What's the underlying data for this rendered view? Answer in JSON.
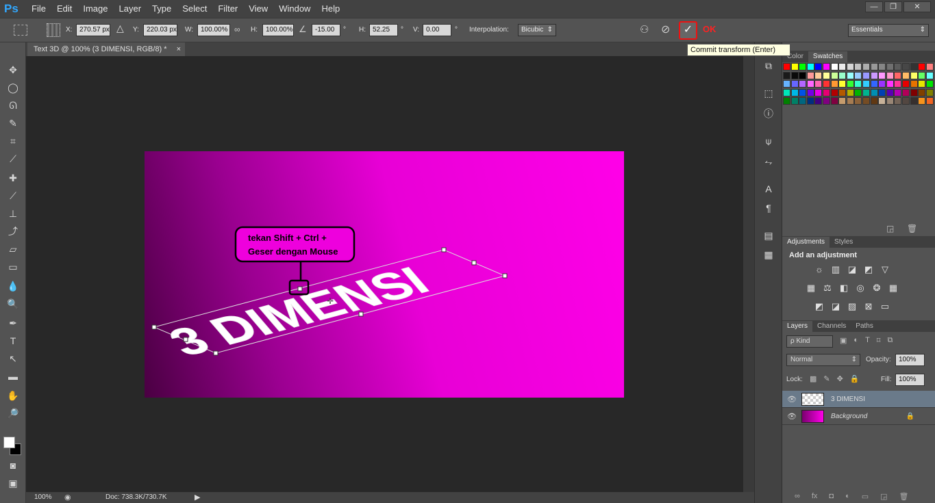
{
  "app": {
    "logo": "Ps"
  },
  "menu": [
    "File",
    "Edit",
    "Image",
    "Layer",
    "Type",
    "Select",
    "Filter",
    "View",
    "Window",
    "Help"
  ],
  "window_controls": {
    "minimize": "—",
    "restore": "❐",
    "close": "✕"
  },
  "options": {
    "x_label": "X:",
    "x_value": "270.57 px",
    "y_label": "Y:",
    "y_value": "220.03 px",
    "w_label": "W:",
    "w_value": "100.00%",
    "h_label": "H:",
    "h_value": "100.00%",
    "angle_value": "-15.00",
    "angle_unit": "°",
    "hskew_label": "H:",
    "hskew_value": "52.25",
    "hskew_unit": "°",
    "vskew_label": "V:",
    "vskew_value": "0.00",
    "vskew_unit": "°",
    "interp_label": "Interpolation:",
    "interp_value": "Bicubic",
    "commit_glyph": "✓",
    "ok_label": "OK",
    "tooltip": "Commit transform (Enter)",
    "workspace": "Essentials"
  },
  "document": {
    "tab_title": "Text 3D @ 100% (3 DIMENSI, RGB/8) *",
    "close": "×",
    "art_text": "3 DIMENSI",
    "annotation_line1": "tekan Shift + Ctrl +",
    "annotation_line2": "Geser dengan Mouse"
  },
  "status": {
    "zoom": "100%",
    "doc": "Doc: 738.3K/730.7K"
  },
  "panels": {
    "color_tabs": [
      "Color",
      "Swatches"
    ],
    "adjust_tabs": [
      "Adjustments",
      "Styles"
    ],
    "adjust_title": "Add an adjustment",
    "layer_tabs": [
      "Layers",
      "Channels",
      "Paths"
    ],
    "kind_label": "ρ Kind",
    "blend_mode": "Normal",
    "opacity_label": "Opacity:",
    "opacity_value": "100%",
    "lock_label": "Lock:",
    "fill_label": "Fill:",
    "fill_value": "100%",
    "layers": [
      {
        "name": "3 DIMENSI",
        "selected": true
      },
      {
        "name": "Background",
        "selected": false,
        "locked": true
      }
    ]
  },
  "swatch_colors": [
    [
      "#ff0000",
      "#ffff00",
      "#00ff00",
      "#00ffff",
      "#0000ff",
      "#ff00ff",
      "#ffffff",
      "#ebebeb",
      "#d6d6d6",
      "#c2c2c2",
      "#adadad",
      "#999999",
      "#858585",
      "#707070",
      "#5c5c5c",
      "#474747",
      "#333333",
      "#ff0000",
      "#ff8080"
    ],
    [
      "#1a1a1a",
      "#0a0a0a",
      "#000000",
      "#ff9999",
      "#ffcc99",
      "#ffff99",
      "#ccff99",
      "#99ffcc",
      "#99ffff",
      "#99ccff",
      "#9999ff",
      "#cc99ff",
      "#ff99ff",
      "#ff99cc",
      "#ff6666",
      "#ffbb66",
      "#ffff66",
      "#66ff66",
      "#66ffff"
    ],
    [
      "#66b3ff",
      "#6666ff",
      "#b366ff",
      "#ff66ff",
      "#ff66b3",
      "#ff3333",
      "#ff9933",
      "#ffff33",
      "#33ff33",
      "#33ffcc",
      "#33ccff",
      "#3366ff",
      "#9933ff",
      "#ff33ff",
      "#ff3399",
      "#e60000",
      "#e67300",
      "#e6e600",
      "#00e600"
    ],
    [
      "#00e6b8",
      "#00b8e6",
      "#0052e6",
      "#7300e6",
      "#e600e6",
      "#e60073",
      "#b30000",
      "#b35900",
      "#b3b300",
      "#00b300",
      "#00b38f",
      "#008fb3",
      "#0040b3",
      "#5900b3",
      "#b300b3",
      "#b30059",
      "#800000",
      "#804000",
      "#808000"
    ],
    [
      "#008000",
      "#008066",
      "#006680",
      "#002e80",
      "#400080",
      "#800080",
      "#800040",
      "#c69c6d",
      "#a67c52",
      "#8c6239",
      "#754c24",
      "#603813",
      "#c7b299",
      "#998675",
      "#736357",
      "#534741",
      "#362f2d",
      "#f7941d",
      "#f26522"
    ]
  ]
}
